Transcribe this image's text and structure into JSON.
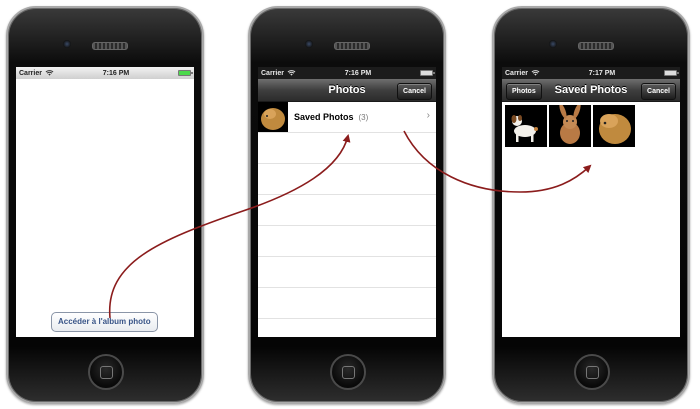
{
  "phone1": {
    "status": {
      "carrier": "Carrier",
      "time": "7:16 PM"
    },
    "button_label": "Accéder à l'album photo"
  },
  "phone2": {
    "status": {
      "carrier": "Carrier",
      "time": "7:16 PM"
    },
    "nav": {
      "title": "Photos",
      "cancel": "Cancel"
    },
    "album": {
      "title": "Saved Photos",
      "count": "(3)"
    }
  },
  "phone3": {
    "status": {
      "carrier": "Carrier",
      "time": "7:17 PM"
    },
    "nav": {
      "back": "Photos",
      "title": "Saved Photos",
      "cancel": "Cancel"
    },
    "photos": [
      "dog-photo",
      "rabbit-photo",
      "hamster-photo"
    ]
  },
  "colors": {
    "arrow": "#8b1c1c",
    "battery_green": "#4cd94c",
    "button_text": "#385487"
  },
  "battery_level": 1.0
}
